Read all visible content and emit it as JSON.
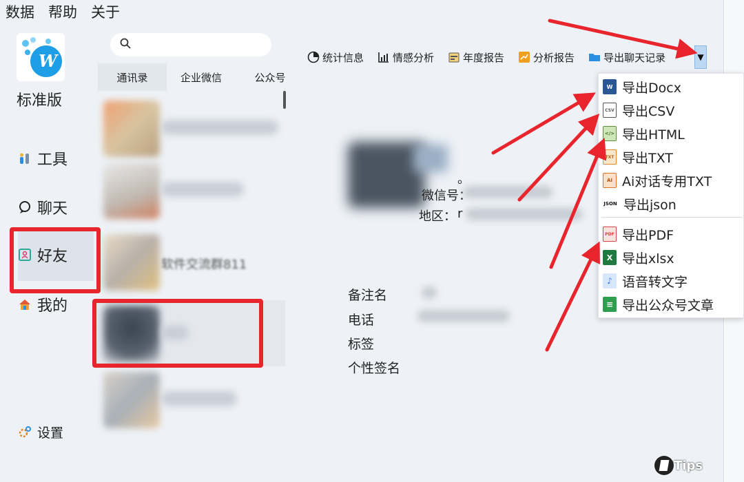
{
  "menubar": {
    "items": [
      "数据",
      "帮助",
      "关于"
    ]
  },
  "sidebar": {
    "logo_letter": "W",
    "edition": "标准版",
    "items": [
      {
        "label": "工具",
        "icon": "tools-icon"
      },
      {
        "label": "聊天",
        "icon": "chat-icon"
      },
      {
        "label": "好友",
        "icon": "contacts-icon"
      },
      {
        "label": "我的",
        "icon": "home-icon"
      }
    ],
    "settings_label": "设置"
  },
  "search": {
    "placeholder": ""
  },
  "tabs": [
    "通讯录",
    "企业微信",
    "公众号"
  ],
  "contacts": [
    {
      "name": ""
    },
    {
      "name": ""
    },
    {
      "name": "软件交流群811"
    },
    {
      "name": ""
    },
    {
      "name": ""
    }
  ],
  "toolbar": {
    "items": [
      {
        "label": "统计信息",
        "icon": "pie-chart-icon"
      },
      {
        "label": "情感分析",
        "icon": "bar-chart-icon"
      },
      {
        "label": "年度报告",
        "icon": "calendar-report-icon"
      },
      {
        "label": "分析报告",
        "icon": "analysis-report-icon"
      },
      {
        "label": "导出聊天记录",
        "icon": "folder-export-icon"
      }
    ],
    "dropdown_glyph": "▼"
  },
  "profile": {
    "wechat_id_label": "微信号：",
    "region_label": "地区：",
    "region_prefix": "r",
    "dot": "。",
    "details": [
      "备注名",
      "电话",
      "标签",
      "个性签名"
    ]
  },
  "export_menu": {
    "items": [
      {
        "label": "导出Docx",
        "icon": "word-icon",
        "badge": "W",
        "color": "#2b5797"
      },
      {
        "label": "导出CSV",
        "icon": "csv-icon",
        "badge": "CSV",
        "color": "#555555"
      },
      {
        "label": "导出HTML",
        "icon": "html-icon",
        "badge": "</>",
        "color": "#5b8f3a"
      },
      {
        "label": "导出TXT",
        "icon": "txt-icon",
        "badge": "TXT",
        "color": "#e08a2b"
      },
      {
        "label": "Ai对话专用TXT",
        "icon": "ai-txt-icon",
        "badge": "AI",
        "color": "#e0702b"
      },
      {
        "label": "导出json",
        "icon": "json-icon",
        "badge": "JSON",
        "color": "#111111"
      },
      {
        "label": "导出PDF",
        "icon": "pdf-icon",
        "badge": "PDF",
        "color": "#e0403a"
      },
      {
        "label": "导出xlsx",
        "icon": "excel-icon",
        "badge": "X",
        "color": "#1f7a3f"
      },
      {
        "label": "语音转文字",
        "icon": "voice-to-text-icon",
        "badge": "♪",
        "color": "#3f7ae0"
      },
      {
        "label": "导出公众号文章",
        "icon": "article-icon",
        "badge": "≡",
        "color": "#2e9e4f"
      }
    ]
  },
  "watermark": {
    "text": "Tips"
  },
  "colors": {
    "annotation_red": "#e8242c",
    "accent_blue": "#1e9ee6"
  }
}
